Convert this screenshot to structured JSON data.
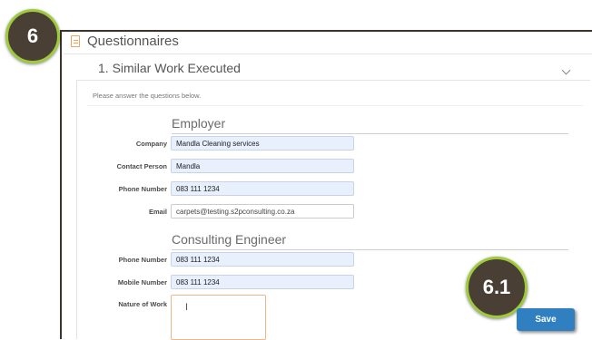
{
  "badges": {
    "step_main": "6",
    "step_save": "6.1"
  },
  "questionnaires": {
    "title": "Questionnaires"
  },
  "section": {
    "title": "1. Similar Work Executed"
  },
  "intro_text": "Please answer the questions below.",
  "employer": {
    "heading": "Employer",
    "fields": [
      {
        "label": "Company",
        "value": "Mandla Cleaning services"
      },
      {
        "label": "Contact Person",
        "value": "Mandla"
      },
      {
        "label": "Phone Number",
        "value": "083 111 1234"
      },
      {
        "label": "Email",
        "value": "carpets@testing.s2pconsulting.co.za"
      }
    ]
  },
  "consulting_engineer": {
    "heading": "Consulting Engineer",
    "fields": [
      {
        "label": "Phone Number",
        "value": "083 111 1234"
      },
      {
        "label": "Mobile Number",
        "value": "083 111 1234"
      },
      {
        "label": "Nature of Work",
        "value": ""
      }
    ]
  },
  "actions": {
    "save_label": "Save"
  },
  "colors": {
    "accent": "#2f7fc1",
    "badge_fill": "#4a3f35",
    "badge_ring": "#9fcb3b",
    "input_autofill": "#e8f0fe",
    "textarea_focus_border": "#f3b48a"
  },
  "icons": {
    "questionnaire": "document-icon",
    "collapse": "chevron-down-icon",
    "text_cursor": "text-cursor-icon"
  }
}
